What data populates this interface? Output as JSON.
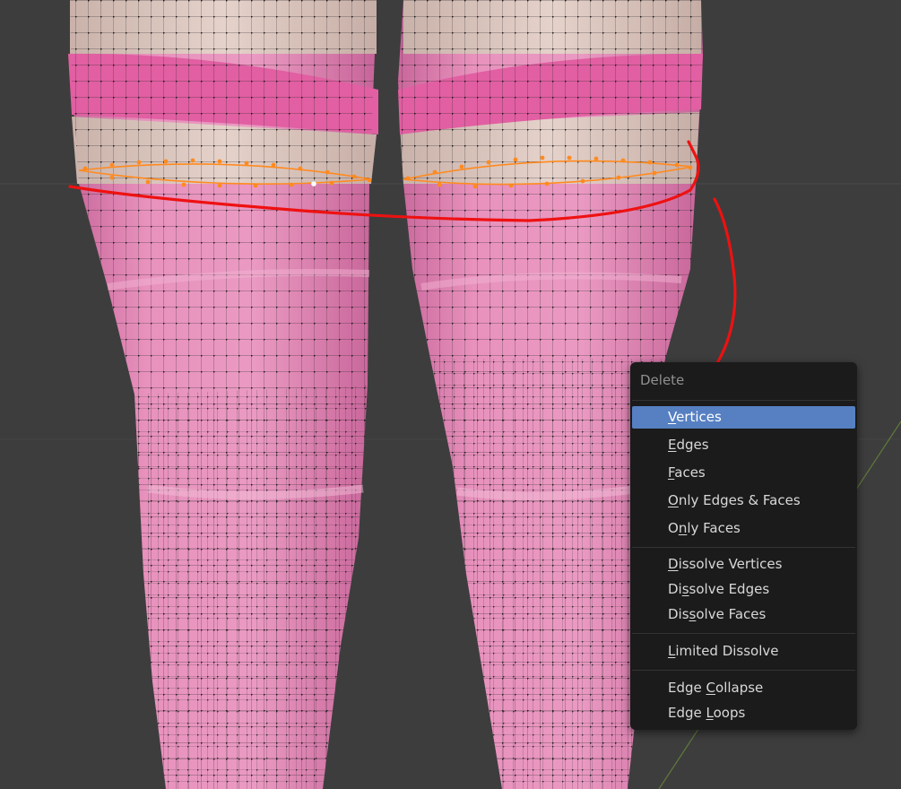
{
  "viewport": {
    "background": "#3d3d3d",
    "mesh_color": "#e48ab5",
    "band_color": "#e05fa2",
    "selection_color": "#ff8a1f",
    "annotation_color": "#ee1111"
  },
  "delete_menu": {
    "title": "Delete",
    "groups": [
      [
        {
          "label": "Vertices",
          "hotkey": "V",
          "active": true
        },
        {
          "label": "Edges",
          "hotkey": "E"
        },
        {
          "label": "Faces",
          "hotkey": "F"
        },
        {
          "label": "Only Edges & Faces",
          "hotkey": "O"
        },
        {
          "label": "Only Faces",
          "hotkey": "n"
        }
      ],
      [
        {
          "label": "Dissolve Vertices",
          "hotkey": "D"
        },
        {
          "label": "Dissolve Edges",
          "hotkey": "s"
        },
        {
          "label": "Dissolve Faces",
          "hotkey": "s"
        }
      ],
      [
        {
          "label": "Limited Dissolve",
          "hotkey": "L"
        }
      ],
      [
        {
          "label": "Edge Collapse",
          "hotkey": "C"
        },
        {
          "label": "Edge Loops",
          "hotkey": "L"
        }
      ]
    ]
  }
}
